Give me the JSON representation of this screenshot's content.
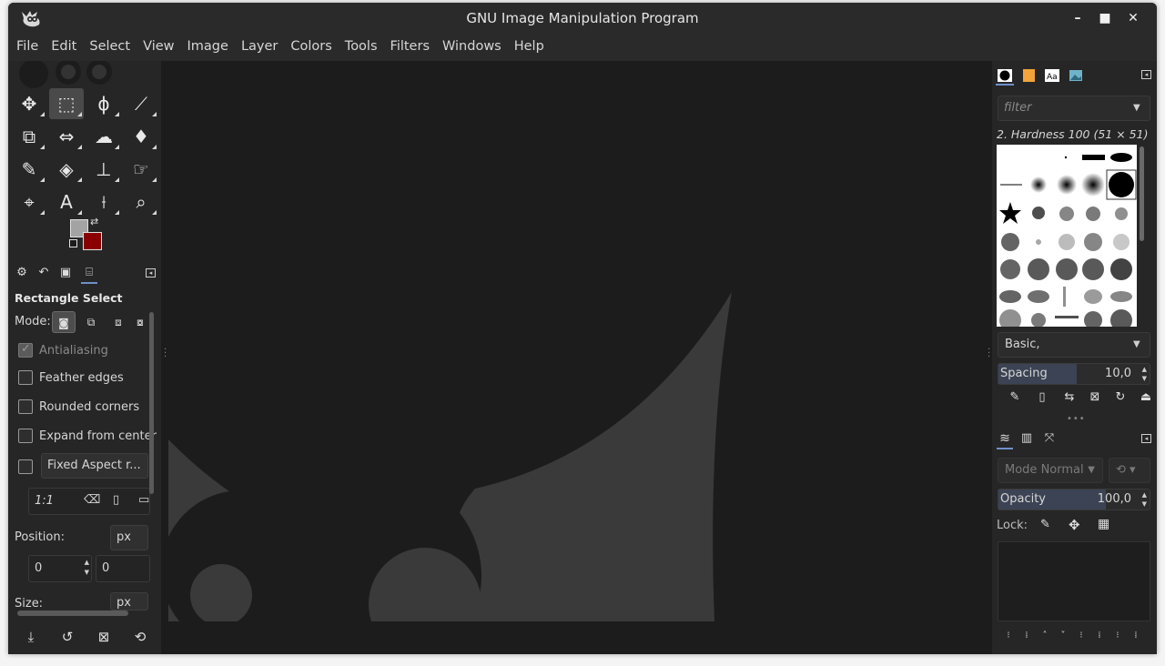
{
  "window": {
    "title": "GNU Image Manipulation Program",
    "controls": [
      "–",
      "■",
      "✕"
    ]
  },
  "menu": [
    "File",
    "Edit",
    "Select",
    "View",
    "Image",
    "Layer",
    "Colors",
    "Tools",
    "Filters",
    "Windows",
    "Help"
  ],
  "colors": {
    "foreground": "#a3a3a3",
    "background": "#8a0000",
    "accent": "#6f8fc9"
  },
  "tools": [
    {
      "name": "move-tool",
      "glyph": "✥"
    },
    {
      "name": "rectangle-select-tool",
      "glyph": "⬚",
      "active": true
    },
    {
      "name": "free-select-tool",
      "glyph": "ϕ"
    },
    {
      "name": "fuzzy-select-tool",
      "glyph": "⟋"
    },
    {
      "name": "crop-tool",
      "glyph": "⧉"
    },
    {
      "name": "unified-transform-tool",
      "glyph": "⇔"
    },
    {
      "name": "warp-transform-tool",
      "glyph": "☁"
    },
    {
      "name": "bucket-fill-tool",
      "glyph": "♦"
    },
    {
      "name": "paintbrush-tool",
      "glyph": "✎"
    },
    {
      "name": "eraser-tool",
      "glyph": "◈"
    },
    {
      "name": "clone-tool",
      "glyph": "⊥"
    },
    {
      "name": "smudge-tool",
      "glyph": "☞"
    },
    {
      "name": "paths-tool",
      "glyph": "⌖"
    },
    {
      "name": "text-tool",
      "glyph": "A"
    },
    {
      "name": "color-picker-tool",
      "glyph": "⟊"
    },
    {
      "name": "zoom-tool",
      "glyph": "⌕"
    }
  ],
  "tool_options": {
    "title": "Rectangle Select",
    "mode_label": "Mode:",
    "antialiasing": "Antialiasing",
    "feather_edges": "Feather edges",
    "rounded_corners": "Rounded corners",
    "expand_from_center": "Expand from center",
    "fixed_combo": "Fixed Aspect r...",
    "ratio_value": "1:1",
    "position_label": "Position:",
    "position_unit": "px",
    "position_x": "0",
    "position_y": "0",
    "size_label": "Size:",
    "size_unit": "px"
  },
  "brushes": {
    "filter_placeholder": "filter",
    "selected": "2. Hardness 100 (51 × 51)",
    "preset": "Basic,",
    "spacing_label": "Spacing",
    "spacing_value": "10,0",
    "spacing_fraction": 0.52
  },
  "layers": {
    "mode_label": "Mode",
    "mode_value": "Normal",
    "opacity_label": "Opacity",
    "opacity_value": "100,0",
    "opacity_fraction": 0.71,
    "lock_label": "Lock:"
  }
}
